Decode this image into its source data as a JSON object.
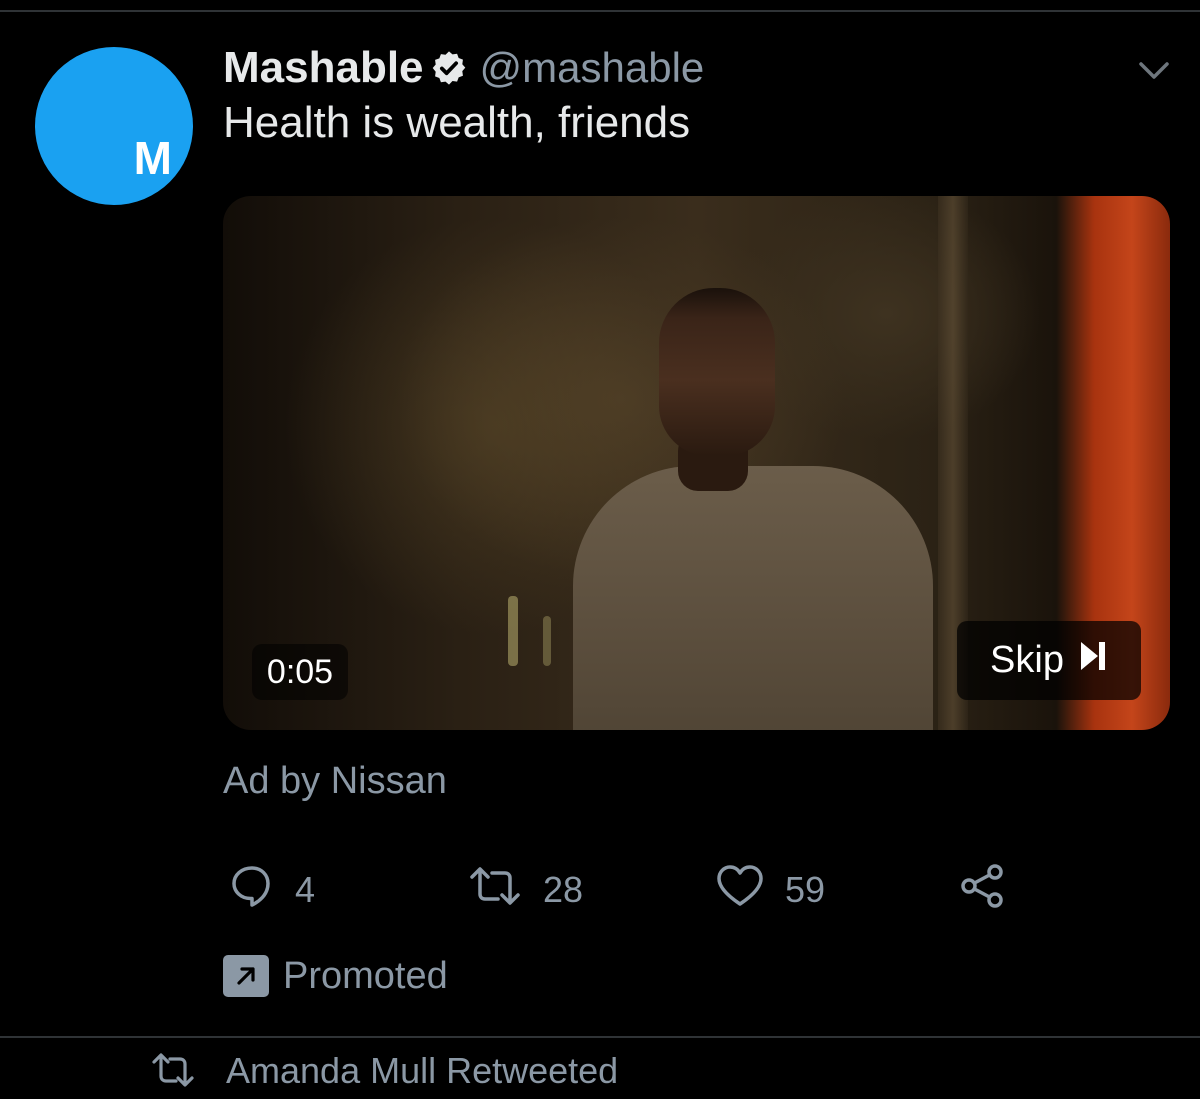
{
  "tweet": {
    "avatar_letter": "M",
    "display_name": "Mashable",
    "handle": "@mashable",
    "text": "Health is wealth, friends",
    "more_icon": "chevron-down-icon",
    "verified_icon": "verified-badge-icon"
  },
  "media": {
    "timestamp": "0:05",
    "skip_label": "Skip",
    "skip_icon": "skip-next-icon"
  },
  "ad_by": "Ad by Nissan",
  "actions": {
    "reply": {
      "icon": "reply-icon",
      "count": "4"
    },
    "retweet": {
      "icon": "retweet-icon",
      "count": "28"
    },
    "like": {
      "icon": "heart-icon",
      "count": "59"
    },
    "share": {
      "icon": "share-icon"
    }
  },
  "promoted": {
    "icon": "promoted-arrow-icon",
    "label": "Promoted"
  },
  "next_tweet": {
    "icon": "retweet-icon",
    "social_context": "Amanda Mull Retweeted"
  },
  "colors": {
    "background": "#000000",
    "avatar": "#1aa1f1",
    "secondary_text": "#8b98a5",
    "primary_text": "#e7e9ea",
    "divider": "#2f3336"
  }
}
